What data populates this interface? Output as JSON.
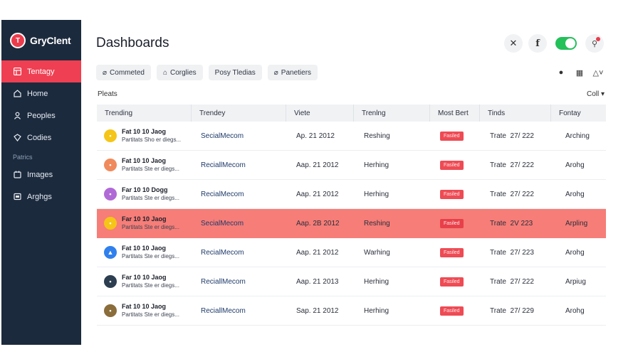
{
  "app": {
    "name": "GryClent",
    "logo_text": "T"
  },
  "sidebar": {
    "items": [
      {
        "label": "Tentagy",
        "icon": "grid-icon"
      },
      {
        "label": "Home",
        "icon": "home-icon"
      },
      {
        "label": "Peoples",
        "icon": "people-icon"
      },
      {
        "label": "Codies",
        "icon": "code-icon"
      }
    ],
    "section": "Patrics",
    "items2": [
      {
        "label": "Images",
        "icon": "image-icon"
      },
      {
        "label": "Arghgs",
        "icon": "settings-icon"
      }
    ]
  },
  "header": {
    "title": "Dashboards"
  },
  "filters": [
    {
      "label": "Commeted",
      "icon": "link-icon"
    },
    {
      "label": "Corglies",
      "icon": "tag-icon"
    },
    {
      "label": "Posy Tledias",
      "icon": ""
    },
    {
      "label": "Panetiers",
      "icon": "link-icon"
    }
  ],
  "section_label": "Pleats",
  "col_select": "Coll ▾",
  "table": {
    "headers": [
      "Trending",
      "Trendey",
      "Viete",
      "Trenlng",
      "Most Bert",
      "Tinds",
      "Fontay"
    ],
    "rows": [
      {
        "name": "Fat 10 10 Jaog",
        "sub": "Partitats Sho er diegs...",
        "source": "SecialMecom",
        "date": "Ap. 21 2012",
        "status": "Reshing",
        "badge": "Fasiled",
        "time": "Trate  27/ 222",
        "tag": "Arching",
        "avatar_color": "#f5c518",
        "avatar_char": "•",
        "highlight": false
      },
      {
        "name": "Fat 10 10 Jaog",
        "sub": "Partitats Ste er diegs...",
        "source": "ReciallMecom",
        "date": "Aap. 21 2012",
        "status": "Herhing",
        "badge": "Fasiled",
        "time": "Trate  27/ 222",
        "tag": "Arohg",
        "avatar_color": "#f08a5d",
        "avatar_char": "•",
        "highlight": false
      },
      {
        "name": "Far 10 10 Dogg",
        "sub": "Partitats Ste er diegs...",
        "source": "RecialMecom",
        "date": "Aap. 21 2012",
        "status": "Herhing",
        "badge": "Fasiled",
        "time": "Trate  27/ 222",
        "tag": "Arohg",
        "avatar_color": "#b06ad6",
        "avatar_char": "•",
        "highlight": false
      },
      {
        "name": "Far 10 10 Jaog",
        "sub": "Partitats Ste er diegs...",
        "source": "SecialMecom",
        "date": "Aap. 2B 2012",
        "status": "Reshing",
        "badge": "Fasiled",
        "time": "Trate  2V 223",
        "tag": "Arpling",
        "avatar_color": "#f5c518",
        "avatar_char": "•",
        "highlight": true
      },
      {
        "name": "Fat 10 10 Jaog",
        "sub": "Partitats Ste er diegs...",
        "source": "RecialMecom",
        "date": "Aap. 21 2012",
        "status": "Warhing",
        "badge": "Fasiled",
        "time": "Trate  27/ 223",
        "tag": "Arohg",
        "avatar_color": "#2f80ed",
        "avatar_char": "▲",
        "highlight": false
      },
      {
        "name": "Far 10 10 Jaog",
        "sub": "Partitats Ste er diegs...",
        "source": "ReciallMecom",
        "date": "Aap. 21 2013",
        "status": "Herhing",
        "badge": "Fasiled",
        "time": "Trate  27/ 222",
        "tag": "Arpiug",
        "avatar_color": "#2c3e50",
        "avatar_char": "•",
        "highlight": false
      },
      {
        "name": "Fat 10 10 Jaog",
        "sub": "Partitats Ste er diegs...",
        "source": "ReciallMecom",
        "date": "Sap. 21 2012",
        "status": "Herhing",
        "badge": "Fasiled",
        "time": "Trate  27/ 229",
        "tag": "Arohg",
        "avatar_color": "#8a6d3b",
        "avatar_char": "•",
        "highlight": false
      }
    ]
  },
  "colors": {
    "sidebar": "#1c2a3d",
    "accent": "#ef3f52",
    "highlight_row": "#f67d78",
    "toggle": "#24c05a"
  }
}
